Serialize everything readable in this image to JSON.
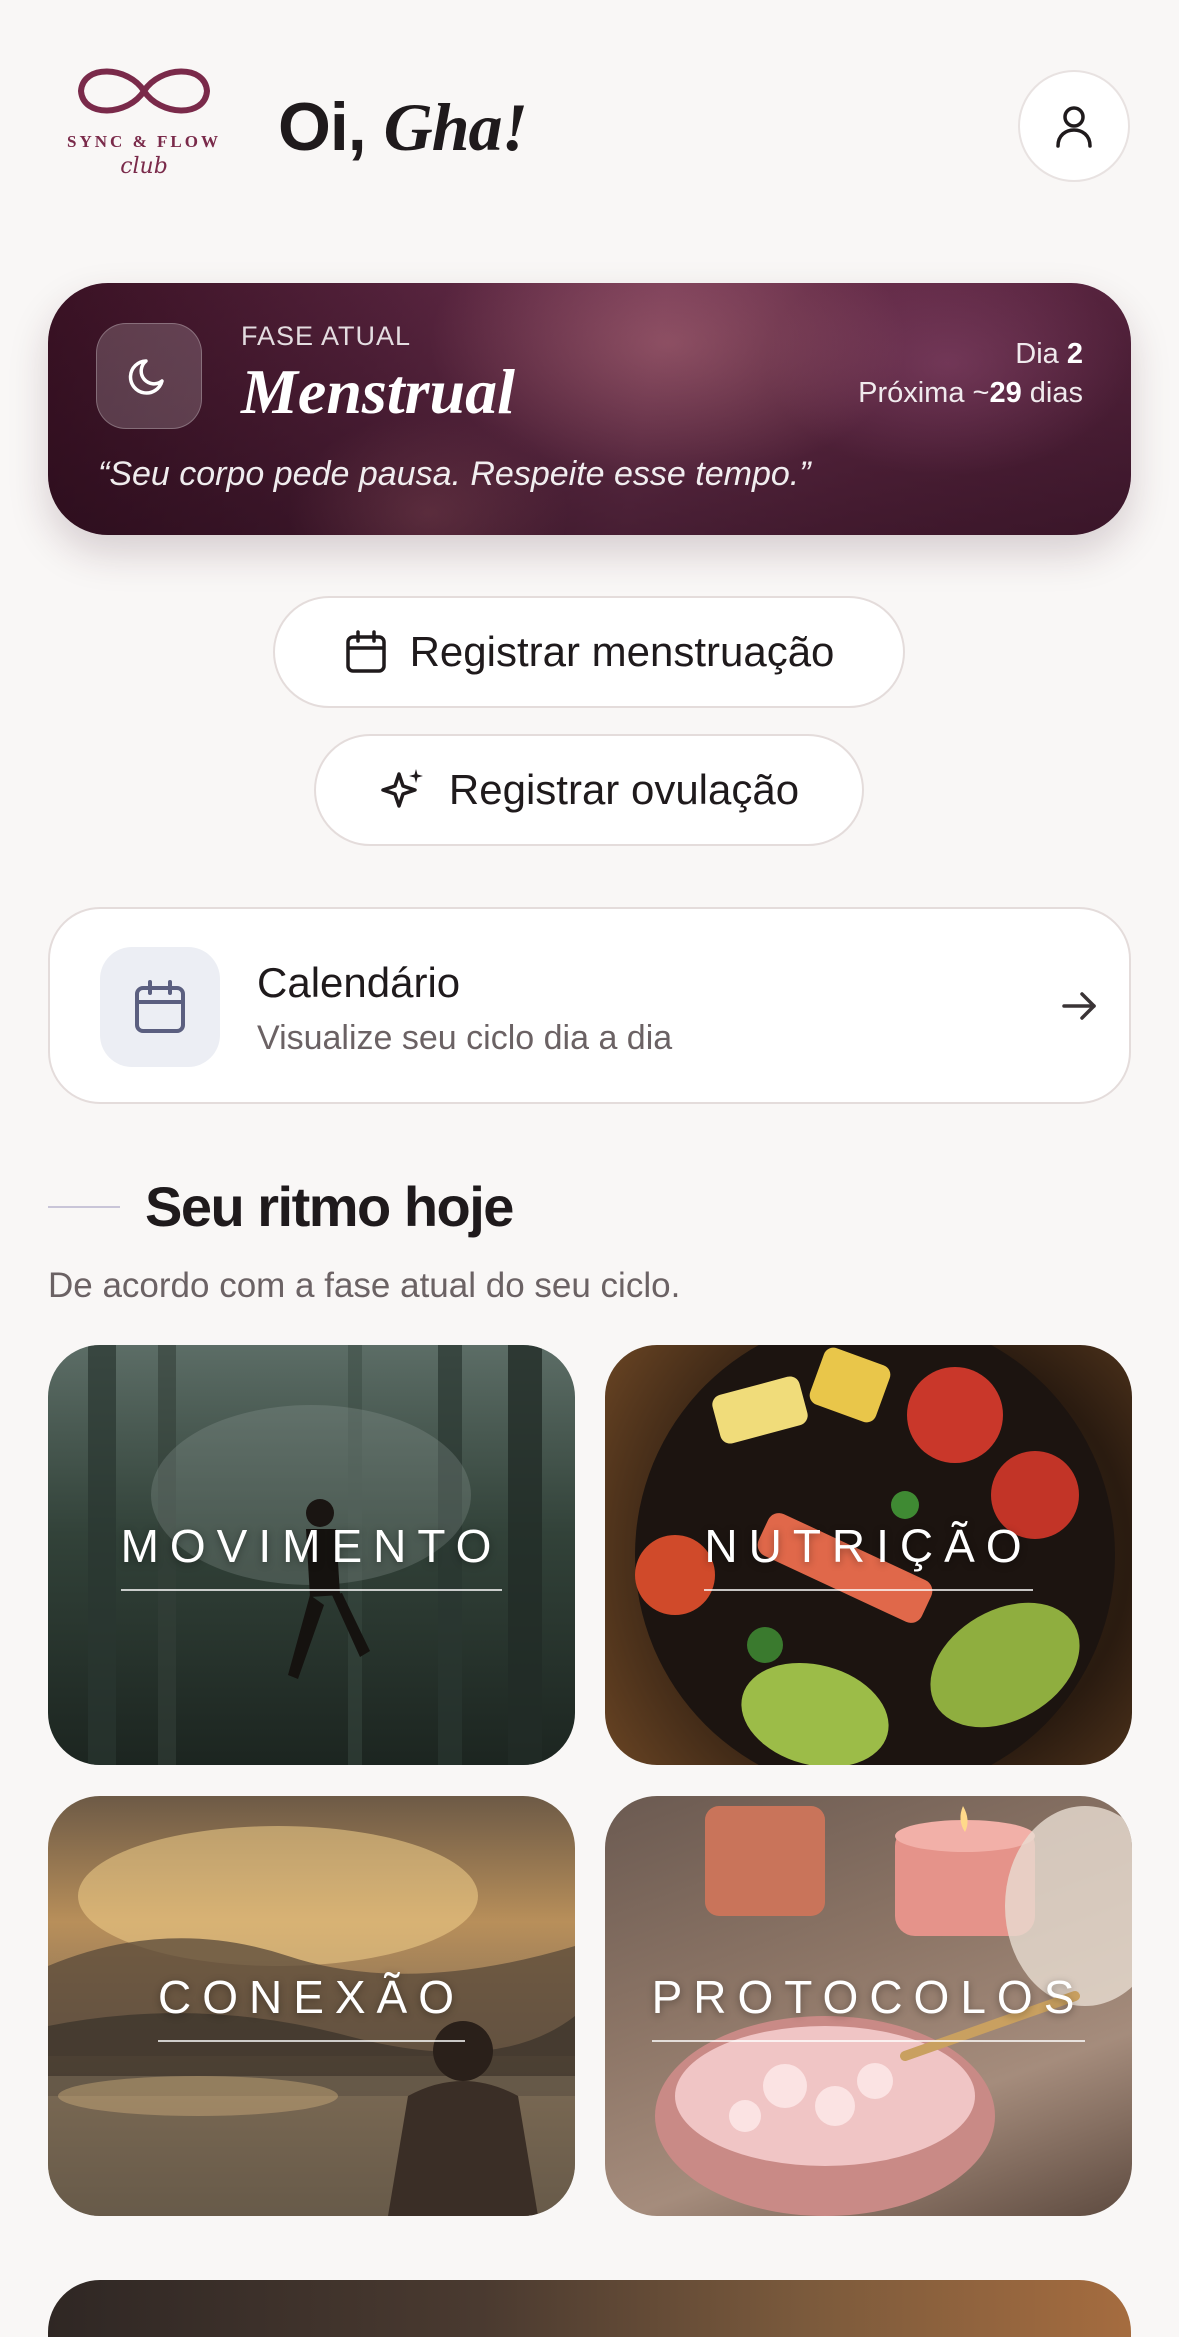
{
  "header": {
    "logo_text": "SYNC & FLOW",
    "logo_sub": "club",
    "greeting_prefix": "Oi,",
    "greeting_name": "Gha!",
    "profile_icon": "user-icon"
  },
  "phase": {
    "label": "FASE ATUAL",
    "name": "Menstrual",
    "day_label": "Dia",
    "day_value": "2",
    "next_label": "Próxima ~",
    "next_value": "29",
    "next_unit": "dias",
    "quote": "“Seu corpo pede pausa. Respeite esse tempo.”",
    "icon": "moon-icon",
    "accent": "#5a2540"
  },
  "actions": {
    "register_menstruation": "Registrar menstruação",
    "register_ovulation": "Registrar ovulação",
    "menstruation_icon": "calendar-icon",
    "ovulation_icon": "sparkles-icon"
  },
  "calendar": {
    "title": "Calendário",
    "subtitle": "Visualize seu ciclo dia a dia",
    "icon": "calendar-icon",
    "arrow_icon": "arrow-right-icon"
  },
  "section": {
    "title": "Seu ritmo hoje",
    "subtitle": "De acordo com a fase atual do seu ciclo."
  },
  "tiles": [
    {
      "label": "MOVIMENTO"
    },
    {
      "label": "NUTRIÇÃO"
    },
    {
      "label": "CONEXÃO"
    },
    {
      "label": "PROTOCOLOS"
    }
  ],
  "colors": {
    "background": "#f9f7f6",
    "brand": "#7a2a4a",
    "text": "#1f1a1c",
    "muted": "#6b6264"
  }
}
